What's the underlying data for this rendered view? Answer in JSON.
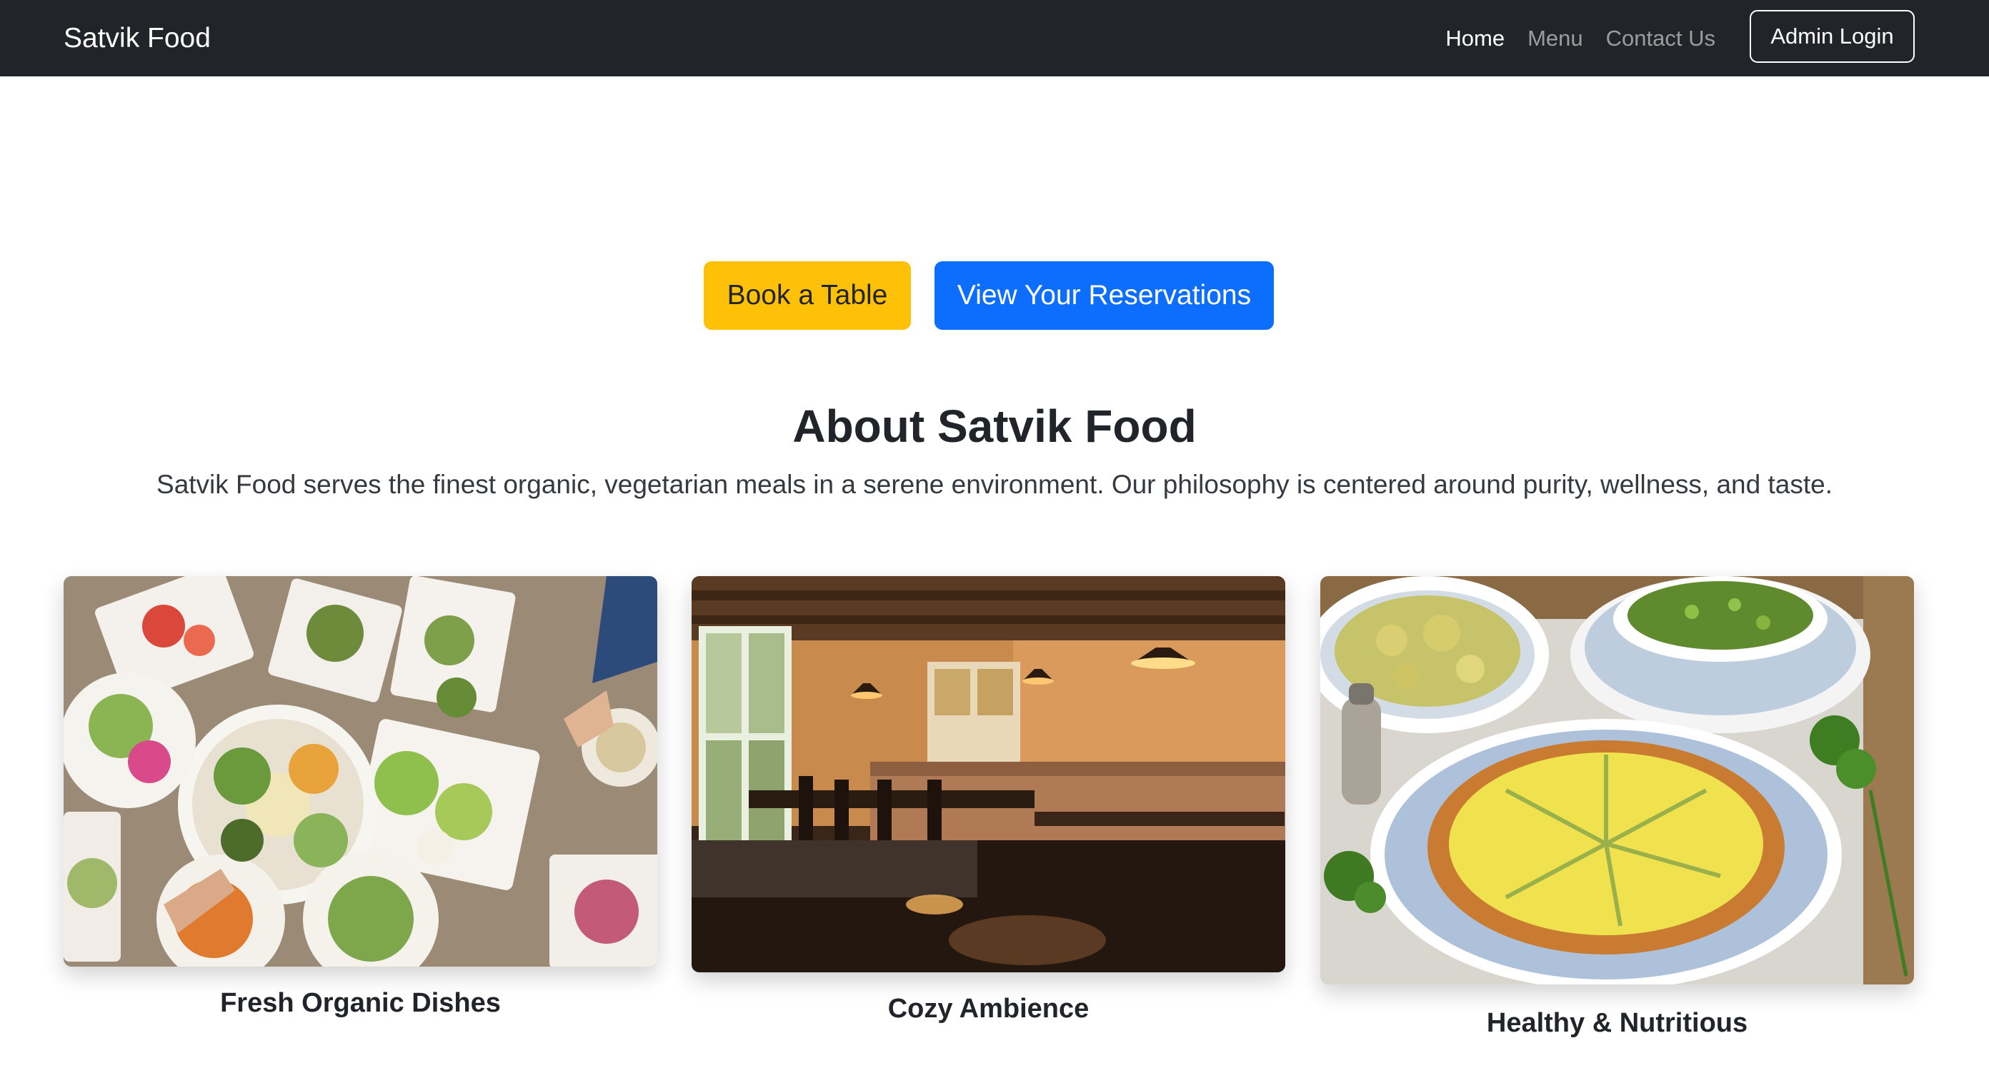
{
  "navbar": {
    "brand": "Satvik Food",
    "links": [
      {
        "label": "Home",
        "active": true
      },
      {
        "label": "Menu",
        "active": false
      },
      {
        "label": "Contact Us",
        "active": false
      }
    ],
    "admin_login": "Admin Login"
  },
  "hero": {
    "book_table": "Book a Table",
    "view_reservations": "View Your Reservations"
  },
  "about": {
    "title": "About Satvik Food",
    "text": "Satvik Food serves the finest organic, vegetarian meals in a serene environment. Our philosophy is centered around purity, wellness, and taste."
  },
  "cards": [
    {
      "caption": "Fresh Organic Dishes",
      "image": "photo-organic-dishes-table"
    },
    {
      "caption": "Cozy Ambience",
      "image": "photo-restaurant-interior"
    },
    {
      "caption": "Healthy & Nutritious",
      "image": "photo-quiche-and-salads"
    }
  ],
  "colors": {
    "navbar_bg": "#212529",
    "book_button": "#ffc107",
    "view_button": "#0d6efd"
  }
}
